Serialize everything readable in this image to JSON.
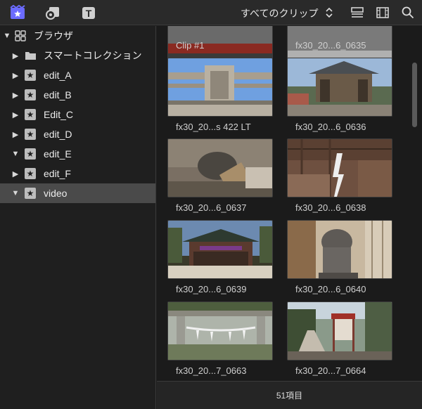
{
  "toolbar": {
    "icons": [
      "libraries-icon",
      "photos-audio-icon",
      "titles-generators-icon",
      "list-view-icon",
      "filmstrip-icon",
      "search-icon"
    ],
    "filter_label": "すべてのクリップ",
    "accent_color": "#6b6bff"
  },
  "sidebar": {
    "items": [
      {
        "label": "ブラウザ",
        "expanded": true,
        "icon": "grid-icon"
      },
      {
        "label": "スマートコレクション",
        "expanded": false,
        "icon": "folder-icon"
      },
      {
        "label": "edit_A",
        "expanded": false,
        "icon": "star-event-icon"
      },
      {
        "label": "edit_B",
        "expanded": false,
        "icon": "star-event-icon"
      },
      {
        "label": "Edit_C",
        "expanded": false,
        "icon": "star-event-icon"
      },
      {
        "label": "edit_D",
        "expanded": false,
        "icon": "star-event-icon"
      },
      {
        "label": "edit_E",
        "expanded": true,
        "icon": "star-event-icon"
      },
      {
        "label": "edit_F",
        "expanded": false,
        "icon": "star-event-icon"
      },
      {
        "label": "video",
        "expanded": true,
        "selected": true,
        "icon": "star-event-icon"
      }
    ]
  },
  "clips": [
    {
      "label": "Clip #1"
    },
    {
      "label": "fx30_20...6_0635"
    },
    {
      "label": "fx30_20...s 422 LT"
    },
    {
      "label": "fx30_20...6_0636"
    },
    {
      "label": "fx30_20...6_0637"
    },
    {
      "label": "fx30_20...6_0638"
    },
    {
      "label": "fx30_20...6_0639"
    },
    {
      "label": "fx30_20...6_0640"
    },
    {
      "label": "fx30_20...7_0663"
    },
    {
      "label": "fx30_20...7_0664"
    }
  ],
  "footer": {
    "item_count": "51項目"
  }
}
